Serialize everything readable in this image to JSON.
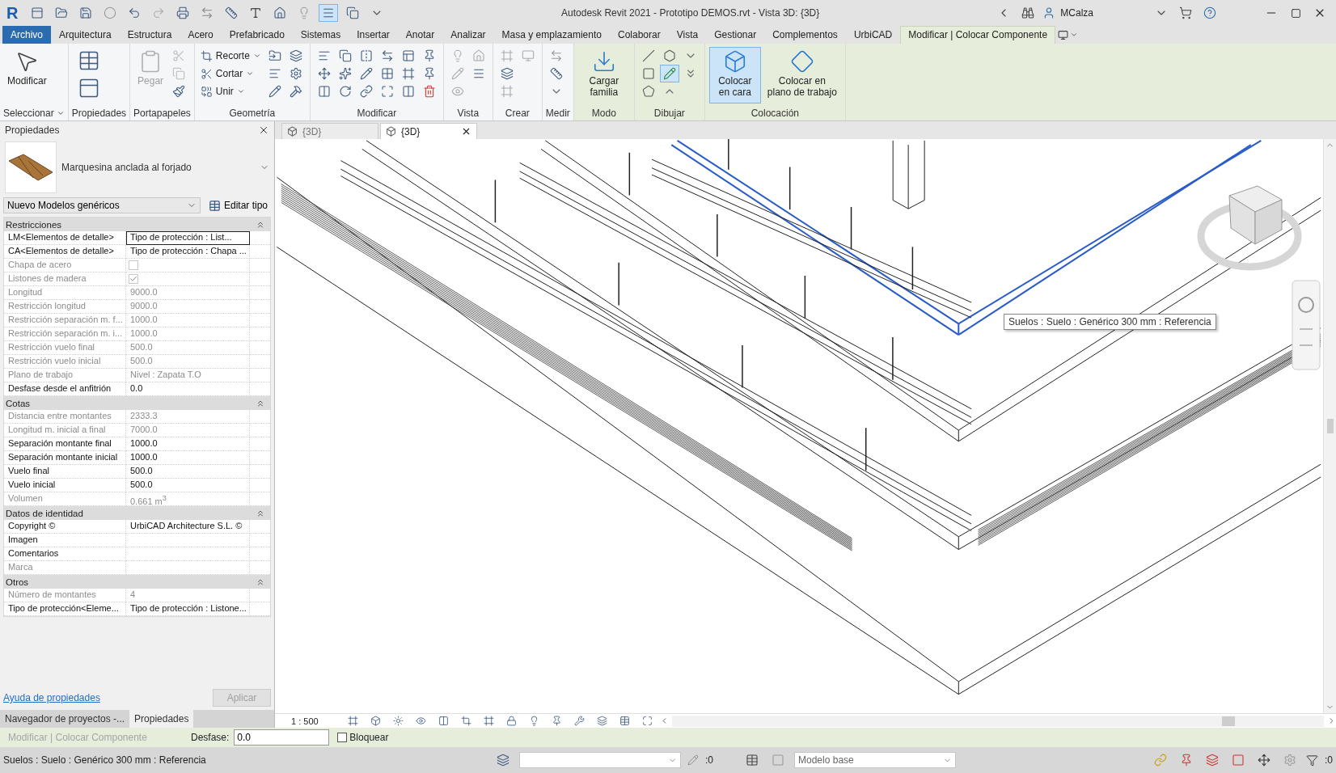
{
  "title_bar": {
    "logo": "R",
    "title": "Autodesk Revit 2021 - Prototipo DEMOS.rvt - Vista 3D: {3D}",
    "user": "MCalza"
  },
  "menu_tabs": [
    {
      "label": "Archivo",
      "kind": "app",
      "selected": false
    },
    {
      "label": "Arquitectura",
      "kind": "tab",
      "selected": false
    },
    {
      "label": "Estructura",
      "kind": "tab",
      "selected": false
    },
    {
      "label": "Acero",
      "kind": "tab",
      "selected": false
    },
    {
      "label": "Prefabricado",
      "kind": "tab",
      "selected": false
    },
    {
      "label": "Sistemas",
      "kind": "tab",
      "selected": false
    },
    {
      "label": "Insertar",
      "kind": "tab",
      "selected": false
    },
    {
      "label": "Anotar",
      "kind": "tab",
      "selected": false
    },
    {
      "label": "Analizar",
      "kind": "tab",
      "selected": false
    },
    {
      "label": "Masa y emplazamiento",
      "kind": "tab",
      "selected": false
    },
    {
      "label": "Colaborar",
      "kind": "tab",
      "selected": false
    },
    {
      "label": "Vista",
      "kind": "tab",
      "selected": false
    },
    {
      "label": "Gestionar",
      "kind": "tab",
      "selected": false
    },
    {
      "label": "Complementos",
      "kind": "tab",
      "selected": false
    },
    {
      "label": "UrbiCAD",
      "kind": "tab",
      "selected": false
    },
    {
      "label": "Modificar | Colocar Componente",
      "kind": "contextual",
      "selected": true
    }
  ],
  "ribbon": {
    "panels": [
      {
        "label": "Seleccionar",
        "menu": true,
        "contextual": false,
        "buttons": [
          {
            "label": "Modificar",
            "kind": "large"
          }
        ]
      },
      {
        "label": "Propiedades",
        "menu": false,
        "contextual": false
      },
      {
        "label": "Portapapeles",
        "menu": false,
        "contextual": false,
        "buttons": [
          {
            "label": "Pegar",
            "kind": "large",
            "disabled": true
          }
        ]
      },
      {
        "label": "Geometría",
        "menu": false,
        "contextual": false,
        "buttons": [
          {
            "label": "Recorte",
            "kind": "small",
            "menu": true
          },
          {
            "label": "Cortar",
            "kind": "small",
            "menu": true
          },
          {
            "label": "Unir",
            "kind": "small",
            "menu": true
          }
        ]
      },
      {
        "label": "Modificar",
        "menu": false,
        "contextual": false
      },
      {
        "label": "Vista",
        "menu": false,
        "contextual": false
      },
      {
        "label": "Crear",
        "menu": false,
        "contextual": false
      },
      {
        "label": "Medir",
        "menu": false,
        "contextual": false
      },
      {
        "label": "Modo",
        "menu": false,
        "contextual": true,
        "buttons": [
          {
            "label": "Cargar familia",
            "kind": "large"
          }
        ]
      },
      {
        "label": "Dibujar",
        "menu": false,
        "contextual": true
      },
      {
        "label": "Colocación",
        "menu": false,
        "contextual": true,
        "buttons": [
          {
            "label": "Colocar en cara",
            "kind": "large",
            "selected": true
          },
          {
            "label": "Colocar en plano de trabajo",
            "kind": "large",
            "selected": false
          }
        ]
      }
    ]
  },
  "properties": {
    "title": "Propiedades",
    "type_name": "Marquesina anclada al forjado",
    "type_selector": "Nuevo Modelos genéricos",
    "edit_type": "Editar tipo",
    "groups": [
      {
        "label": "Restricciones",
        "expanded": true,
        "rows": [
          {
            "name": "LM<Elementos de detalle>",
            "kind": "text",
            "value": "Tipo de protección : List...",
            "disabled": false,
            "selected": true
          },
          {
            "name": "CA<Elementos de detalle>",
            "kind": "text",
            "value": "Tipo de protección : Chapa ...",
            "disabled": false,
            "selected": false
          },
          {
            "name": "Chapa de acero",
            "kind": "check",
            "checked": false,
            "disabled": true,
            "selected": false
          },
          {
            "name": "Listones de madera",
            "kind": "check",
            "checked": true,
            "disabled": true,
            "selected": false
          },
          {
            "name": "Longitud",
            "kind": "text",
            "value": "9000.0",
            "disabled": true,
            "selected": false
          },
          {
            "name": "Restricción longitud",
            "kind": "text",
            "value": "9000.0",
            "disabled": true,
            "selected": false
          },
          {
            "name": "Restricción separación m. f...",
            "kind": "text",
            "value": "1000.0",
            "disabled": true,
            "selected": false
          },
          {
            "name": "Restricción separación m. i...",
            "kind": "text",
            "value": "1000.0",
            "disabled": true,
            "selected": false
          },
          {
            "name": "Restricción vuelo final",
            "kind": "text",
            "value": "500.0",
            "disabled": true,
            "selected": false
          },
          {
            "name": "Restricción vuelo inicial",
            "kind": "text",
            "value": "500.0",
            "disabled": true,
            "selected": false
          },
          {
            "name": "Plano de trabajo",
            "kind": "text",
            "value": "Nivel : Zapata T.O",
            "disabled": true,
            "selected": false
          },
          {
            "name": "Desfase desde el anfitrión",
            "kind": "text",
            "value": "0.0",
            "disabled": false,
            "selected": false
          }
        ]
      },
      {
        "label": "Cotas",
        "expanded": true,
        "rows": [
          {
            "name": "Distancia entre montantes",
            "kind": "text",
            "value": "2333.3",
            "disabled": true,
            "selected": false
          },
          {
            "name": "Longitud m. inicial a final",
            "kind": "text",
            "value": "7000.0",
            "disabled": true,
            "selected": false
          },
          {
            "name": "Separación montante final",
            "kind": "text",
            "value": "1000.0",
            "disabled": false,
            "selected": false
          },
          {
            "name": "Separación montante inicial",
            "kind": "text",
            "value": "1000.0",
            "disabled": false,
            "selected": false
          },
          {
            "name": "Vuelo final",
            "kind": "text",
            "value": "500.0",
            "disabled": false,
            "selected": false
          },
          {
            "name": "Vuelo inicial",
            "kind": "text",
            "value": "500.0",
            "disabled": false,
            "selected": false
          },
          {
            "name": "Volumen",
            "kind": "text",
            "value": "0.661 m$^{3}$",
            "disabled": true,
            "selected": false
          }
        ]
      },
      {
        "label": "Datos de identidad",
        "expanded": true,
        "rows": [
          {
            "name": "Copyright ©",
            "kind": "text",
            "value": "UrbiCAD Architecture S.L. ©",
            "disabled": false,
            "selected": false
          },
          {
            "name": "Imagen",
            "kind": "text",
            "disabled": false,
            "selected": false
          },
          {
            "name": "Comentarios",
            "kind": "text",
            "disabled": false,
            "selected": false
          },
          {
            "name": "Marca",
            "kind": "text",
            "disabled": true,
            "selected": false
          }
        ]
      },
      {
        "label": "Otros",
        "expanded": true,
        "rows": [
          {
            "name": "Número de montantes",
            "kind": "text",
            "value": "4",
            "disabled": true,
            "selected": false
          },
          {
            "name": "Tipo de protección<Eleme...",
            "kind": "text",
            "value": "Tipo de protección : Listone...",
            "disabled": false,
            "selected": false
          }
        ]
      }
    ],
    "help_link": "Ayuda de propiedades",
    "apply": {
      "label": "Aplicar",
      "disabled": true
    }
  },
  "panel_tabs": [
    {
      "label": "Navegador de proyectos -...",
      "selected": false
    },
    {
      "label": "Propiedades",
      "selected": true
    }
  ],
  "view_tabs": [
    {
      "label": "{3D}",
      "selected": false,
      "closable": false
    },
    {
      "label": "{3D}",
      "selected": true,
      "closable": true
    }
  ],
  "viewport": {
    "tooltip": "Suelos : Suelo : Genérico 300 mm : Referencia",
    "scale": "1 : 500"
  },
  "options_bar": {
    "context": "Modificar | Colocar Componente",
    "offset_label": "Desfase:",
    "offset_value": "0.0",
    "lock": {
      "label": "Bloquear",
      "checked": false
    }
  },
  "status_bar": {
    "message": "Suelos : Suelo : Genérico 300 mm : Referencia",
    "workset_count": ":0",
    "design_option": "Modelo base",
    "filter_count": ":0"
  }
}
